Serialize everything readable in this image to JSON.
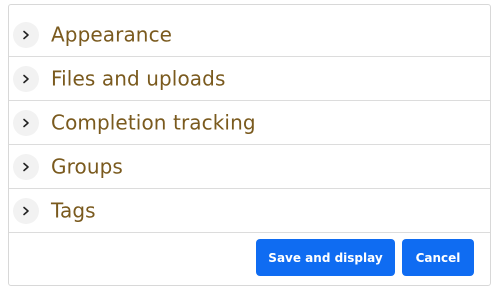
{
  "sections": [
    {
      "label": "Appearance",
      "icon": "chevron-right-icon"
    },
    {
      "label": "Files and uploads",
      "icon": "chevron-right-icon"
    },
    {
      "label": "Completion tracking",
      "icon": "chevron-right-icon"
    },
    {
      "label": "Groups",
      "icon": "chevron-right-icon"
    },
    {
      "label": "Tags",
      "icon": "chevron-right-icon"
    }
  ],
  "actions": {
    "save_label": "Save and display",
    "cancel_label": "Cancel"
  },
  "colors": {
    "section_label": "#7a5a1e",
    "primary_button": "#0f6cf2"
  }
}
